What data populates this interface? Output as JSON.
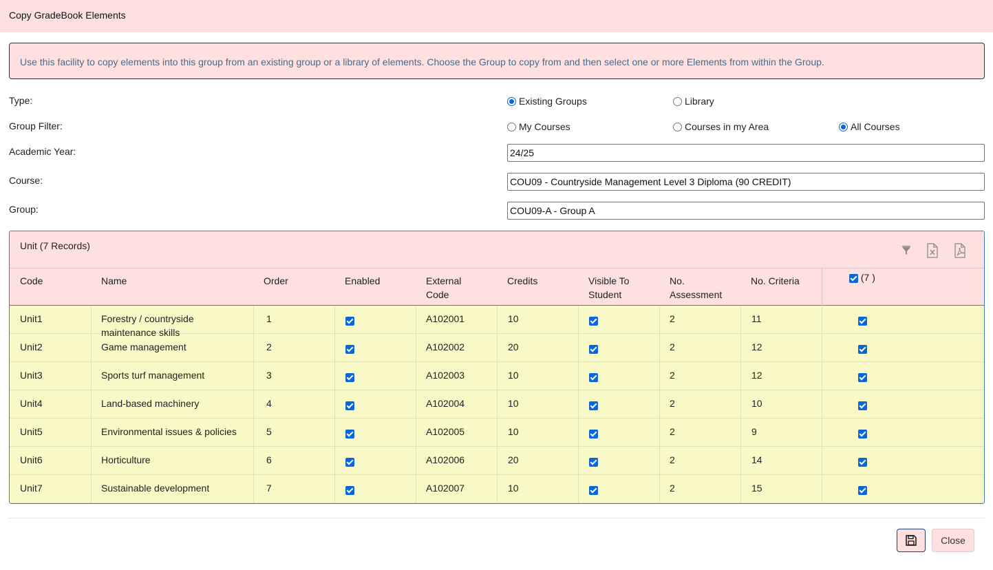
{
  "dialog": {
    "title": "Copy GradeBook Elements",
    "info": "Use this facility to copy elements into this group from an existing group or a library of elements. Choose the Group to copy from and then select one or more Elements from within the Group."
  },
  "form": {
    "type_label": "Type:",
    "type_options": [
      {
        "label": "Existing Groups",
        "selected": true
      },
      {
        "label": "Library",
        "selected": false
      }
    ],
    "group_filter_label": "Group Filter:",
    "group_filter_options": [
      {
        "label": "My Courses",
        "selected": false
      },
      {
        "label": "Courses in my Area",
        "selected": false
      },
      {
        "label": "All Courses",
        "selected": true
      }
    ],
    "academic_year_label": "Academic Year:",
    "academic_year_value": "24/25",
    "course_label": "Course:",
    "course_value": "COU09 - Countryside Management Level 3 Diploma (90 CREDIT)",
    "group_label": "Group:",
    "group_value": "COU09-A - Group A"
  },
  "grid": {
    "title": "Unit (7 Records)",
    "toolbar_icons": [
      "filter-icon",
      "excel-export-icon",
      "pdf-export-icon"
    ],
    "columns": [
      "Code",
      "Name",
      "Order",
      "Enabled",
      "External Code",
      "Credits",
      "Visible To Student",
      "No. Assessment",
      "No. Criteria"
    ],
    "columns_wrapped": {
      "external_code": [
        "External",
        "Code"
      ],
      "visible": [
        "Visible To",
        "Student"
      ],
      "assessment": [
        "No.",
        "Assessment"
      ]
    },
    "select_all_label": "(7 )",
    "select_all_checked": true,
    "rows": [
      {
        "code": "Unit1",
        "name": "Forestry / countryside maintenance skills",
        "name_lines": [
          "Forestry / countryside",
          "maintenance skills"
        ],
        "order": "1",
        "enabled": true,
        "external_code": "A102001",
        "credits": "10",
        "visible": true,
        "assessments": "2",
        "criteria": "11",
        "selected": true
      },
      {
        "code": "Unit2",
        "name": "Game management",
        "name_lines": [
          "Game management"
        ],
        "order": "2",
        "enabled": true,
        "external_code": "A102002",
        "credits": "20",
        "visible": true,
        "assessments": "2",
        "criteria": "12",
        "selected": true
      },
      {
        "code": "Unit3",
        "name": "Sports turf management",
        "name_lines": [
          "Sports turf management"
        ],
        "order": "3",
        "enabled": true,
        "external_code": "A102003",
        "credits": "10",
        "visible": true,
        "assessments": "2",
        "criteria": "12",
        "selected": true
      },
      {
        "code": "Unit4",
        "name": "Land-based machinery",
        "name_lines": [
          "Land-based machinery"
        ],
        "order": "4",
        "enabled": true,
        "external_code": "A102004",
        "credits": "10",
        "visible": true,
        "assessments": "2",
        "criteria": "10",
        "selected": true
      },
      {
        "code": "Unit5",
        "name": "Environmental issues & policies",
        "name_lines": [
          "Environmental issues & policies"
        ],
        "order": "5",
        "enabled": true,
        "external_code": "A102005",
        "credits": "10",
        "visible": true,
        "assessments": "2",
        "criteria": "9",
        "selected": true
      },
      {
        "code": "Unit6",
        "name": "Horticulture",
        "name_lines": [
          "Horticulture"
        ],
        "order": "6",
        "enabled": true,
        "external_code": "A102006",
        "credits": "20",
        "visible": true,
        "assessments": "2",
        "criteria": "14",
        "selected": true
      },
      {
        "code": "Unit7",
        "name": "Sustainable development",
        "name_lines": [
          "Sustainable development"
        ],
        "order": "7",
        "enabled": true,
        "external_code": "A102007",
        "credits": "10",
        "visible": true,
        "assessments": "2",
        "criteria": "15",
        "selected": true
      }
    ]
  },
  "footer": {
    "save_icon": "save-icon",
    "close_label": "Close"
  },
  "colors": {
    "accent": "#0a66d9",
    "header_bg": "#fde0df",
    "row_bg": "#f9f9c8",
    "grid_border": "#3b83c0"
  }
}
